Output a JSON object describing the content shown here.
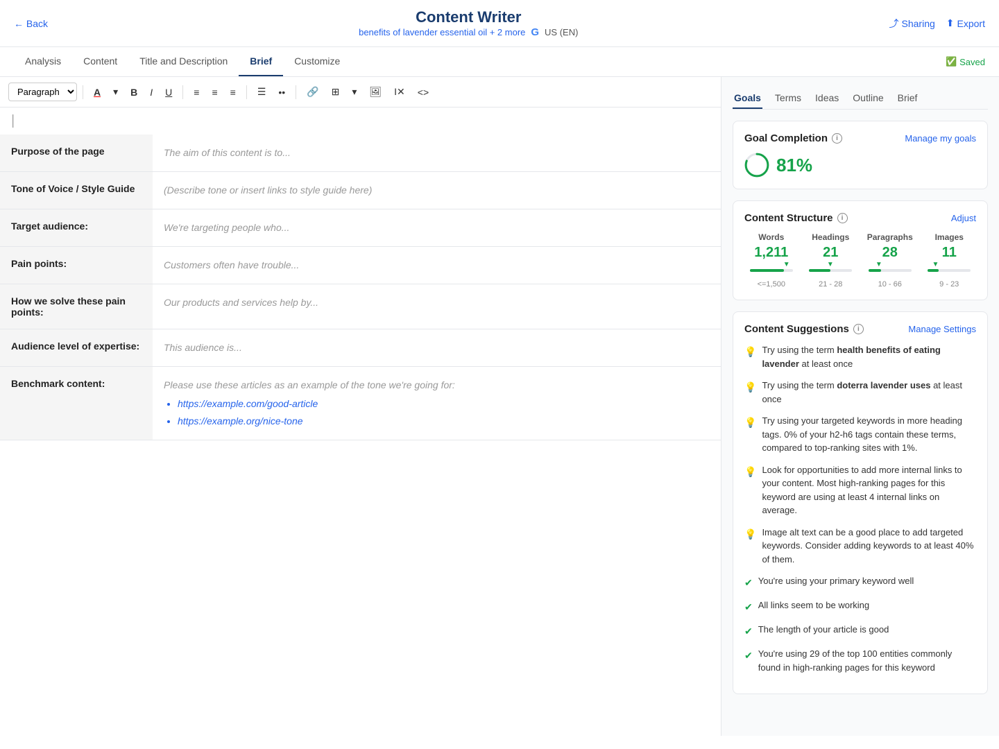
{
  "header": {
    "back_label": "← Back",
    "title": "Content Writer",
    "subtitle": "benefits of lavender essential oil + 2 more",
    "locale": "US (EN)",
    "sharing_label": "Sharing",
    "export_label": "Export"
  },
  "nav": {
    "tabs": [
      {
        "id": "analysis",
        "label": "Analysis"
      },
      {
        "id": "content",
        "label": "Content"
      },
      {
        "id": "title-desc",
        "label": "Title and Description"
      },
      {
        "id": "brief",
        "label": "Brief"
      },
      {
        "id": "customize",
        "label": "Customize"
      }
    ],
    "active_tab": "Brief",
    "saved_label": "Saved"
  },
  "toolbar": {
    "paragraph_select": "Paragraph",
    "buttons": [
      "A",
      "B",
      "I",
      "U",
      "≡",
      "≡",
      "≡",
      "≡",
      "≡",
      "🔗",
      "⊞",
      "⊟",
      "Ι×",
      "<>"
    ]
  },
  "brief_rows": [
    {
      "label": "Purpose of the page",
      "placeholder": "The aim of this content is to..."
    },
    {
      "label": "Tone of Voice / Style Guide",
      "placeholder": "(Describe tone or insert links to style guide here)"
    },
    {
      "label": "Target audience:",
      "placeholder": "We're targeting people who..."
    },
    {
      "label": "Pain points:",
      "placeholder": "Customers often have trouble..."
    },
    {
      "label": "How we solve these pain points: ",
      "placeholder": "Our products and services help by..."
    },
    {
      "label": "Audience level of expertise:",
      "placeholder": "This audience is..."
    },
    {
      "label": "Benchmark content:",
      "placeholder": "Please use these articles as an example of the tone we're going for:",
      "benchmark_links": [
        "https://example.com/good-article",
        "https://example.org/nice-tone"
      ]
    }
  ],
  "sidebar": {
    "tabs": [
      {
        "id": "goals",
        "label": "Goals"
      },
      {
        "id": "terms",
        "label": "Terms"
      },
      {
        "id": "ideas",
        "label": "Ideas"
      },
      {
        "id": "outline",
        "label": "Outline"
      },
      {
        "id": "brief",
        "label": "Brief"
      }
    ],
    "active_tab": "Goals",
    "goal_completion": {
      "title": "Goal Completion",
      "manage_goals_label": "Manage my goals",
      "percent": "81%"
    },
    "content_structure": {
      "title": "Content Structure",
      "adjust_label": "Adjust",
      "items": [
        {
          "label": "Words",
          "value": "1,211",
          "fill_percent": 80,
          "range": "<=1,500"
        },
        {
          "label": "Headings",
          "value": "21",
          "fill_percent": 50,
          "range": "21 - 28"
        },
        {
          "label": "Paragraphs",
          "value": "28",
          "fill_percent": 30,
          "range": "10 - 66"
        },
        {
          "label": "Images",
          "value": "11",
          "fill_percent": 25,
          "range": "9 - 23"
        }
      ]
    },
    "content_suggestions": {
      "title": "Content Suggestions",
      "manage_settings_label": "Manage Settings",
      "suggestions": [
        {
          "type": "bulb",
          "text": "Try using the term **health benefits of eating lavender** at least once"
        },
        {
          "type": "bulb",
          "text": "Try using the term **doterra lavender uses** at least once"
        },
        {
          "type": "bulb",
          "text": "Try using your targeted keywords in more heading tags. 0% of your h2-h6 tags contain these terms, compared to top-ranking sites with 1%."
        },
        {
          "type": "bulb",
          "text": "Look for opportunities to add more internal links to your content. Most high-ranking pages for this keyword are using at least 4 internal links on average."
        },
        {
          "type": "bulb",
          "text": "Image alt text can be a good place to add targeted keywords. Consider adding keywords to at least 40% of them."
        },
        {
          "type": "check",
          "text": "You're using your primary keyword well"
        },
        {
          "type": "check",
          "text": "All links seem to be working"
        },
        {
          "type": "check",
          "text": "The length of your article is good"
        },
        {
          "type": "check",
          "text": "You're using 29 of the top 100 entities commonly found in high-ranking pages for this keyword"
        }
      ]
    }
  }
}
